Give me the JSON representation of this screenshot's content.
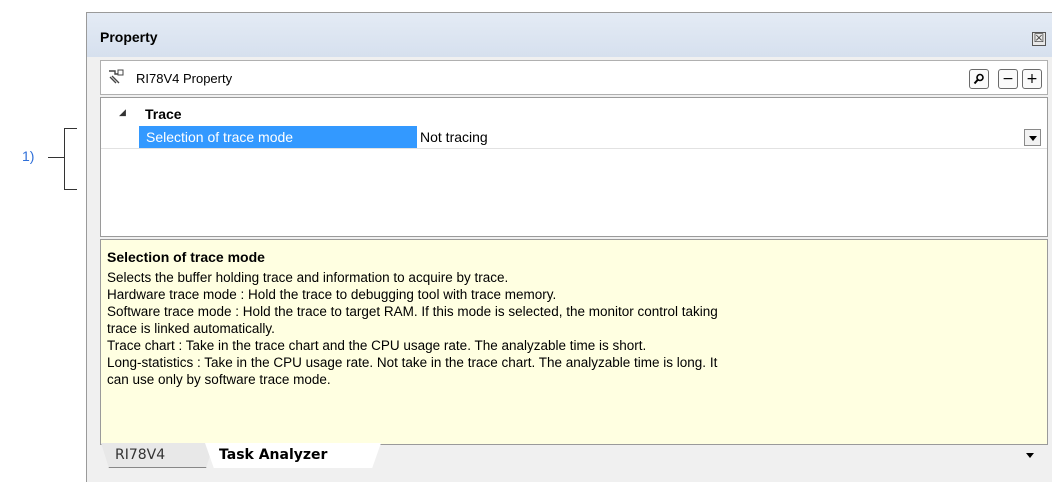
{
  "annotation": {
    "label": "1)"
  },
  "window": {
    "title": "Property",
    "close_glyph": "☒"
  },
  "toolbar": {
    "icon": "property-panel-icon",
    "title": "RI78V4 Property",
    "search_glyph": "🔍",
    "minus_label": "−",
    "plus_label": "+"
  },
  "grid": {
    "category": {
      "toggle_glyph": "◢",
      "label": "Trace"
    },
    "row": {
      "name": "Selection of trace mode",
      "value": "Not tracing"
    }
  },
  "description": {
    "title": "Selection of trace mode",
    "lines": [
      "Selects the buffer holding trace and information to acquire by trace.",
      "Hardware trace mode : Hold the trace to debugging tool with trace memory.",
      "Software trace mode : Hold the trace to target RAM. If this mode is selected, the monitor control taking",
      "trace is linked automatically.",
      "Trace chart : Take in the trace chart and the CPU usage rate. The analyzable time is short.",
      "Long-statistics : Take in the CPU usage rate. Not take in the trace chart. The analyzable time is long. It",
      "can use only by software trace mode."
    ]
  },
  "tabs": [
    {
      "label": "RI78V4"
    },
    {
      "label": "Task Analyzer"
    }
  ],
  "colors": {
    "selection": "#3399ff",
    "description_bg": "#ffffe1",
    "annotation": "#2f6fd8"
  }
}
